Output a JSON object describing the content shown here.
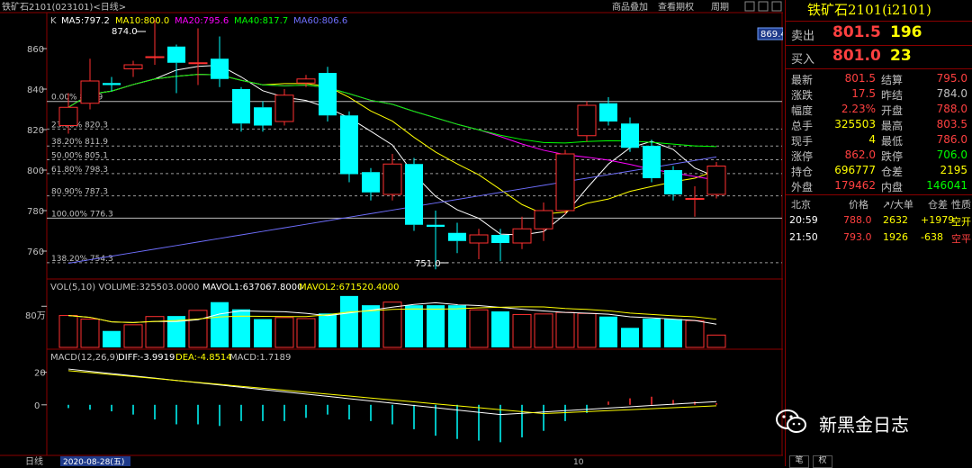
{
  "header": {
    "instrument": "铁矿石2101(023101)<日线>",
    "menu": [
      "商品叠加",
      "查看期权",
      "周期"
    ]
  },
  "overlays": {
    "ma_legend": [
      {
        "text": "K",
        "color": "#c0c0c0"
      },
      {
        "text": "MA5:797.2",
        "color": "#ffffff"
      },
      {
        "text": "MA10:800.0",
        "color": "#ffff00"
      },
      {
        "text": "MA20:795.6",
        "color": "#ff00ff"
      },
      {
        "text": "MA40:817.7",
        "color": "#00ff00"
      },
      {
        "text": "MA60:806.6",
        "color": "#6f6fff"
      }
    ],
    "price_tag": "869.4",
    "high_label": "874.0",
    "low_label": "751.0",
    "fib_levels": [
      {
        "label": "0.00% 833.9",
        "price": 833.9
      },
      {
        "label": "23.60% 820.3",
        "price": 820.3
      },
      {
        "label": "38.20% 811.9",
        "price": 811.9
      },
      {
        "label": "50.00% 805.1",
        "price": 805.1
      },
      {
        "label": "61.80% 798.3",
        "price": 798.3
      },
      {
        "label": "80.90% 787.3",
        "price": 787.3
      },
      {
        "label": "100.00% 776.3",
        "price": 776.3
      },
      {
        "label": "138.20% 754.3",
        "price": 754.3
      }
    ],
    "volume_legend": "VOL(5,10) VOLUME:325503.0000",
    "volume_mavol1": "MAVOL1:637067.8000",
    "volume_mavol2": "MAVOL2:671520.4000",
    "volume_axis_label": "80万",
    "macd_legend": "MACD(12,26,9)",
    "macd_diff": "DIFF:-3.9919",
    "macd_dea": "DEA:-4.8514",
    "macd_val": "MACD:1.7189",
    "bottom_period": "日线",
    "bottom_date": "2020-08-28(五)",
    "bottom_tick": "10"
  },
  "chart_data": {
    "type": "candlestick",
    "price_axis_ticks": [
      860,
      840,
      820,
      800,
      780,
      760
    ],
    "price_range": [
      748,
      876
    ],
    "candles": [
      {
        "o": 822,
        "c": 831,
        "h": 838,
        "l": 818
      },
      {
        "o": 833,
        "c": 844,
        "h": 855,
        "l": 830
      },
      {
        "o": 843,
        "c": 842,
        "h": 846,
        "l": 839
      },
      {
        "o": 850,
        "c": 852,
        "h": 854,
        "l": 846
      },
      {
        "o": 856,
        "c": 856,
        "h": 874,
        "l": 852
      },
      {
        "o": 861,
        "c": 853,
        "h": 862,
        "l": 838
      },
      {
        "o": 853,
        "c": 853,
        "h": 870,
        "l": 842
      },
      {
        "o": 855,
        "c": 845,
        "h": 866,
        "l": 841
      },
      {
        "o": 840,
        "c": 823,
        "h": 841,
        "l": 819
      },
      {
        "o": 831,
        "c": 822,
        "h": 834,
        "l": 819
      },
      {
        "o": 824,
        "c": 837,
        "h": 840,
        "l": 822
      },
      {
        "o": 843,
        "c": 845,
        "h": 847,
        "l": 841
      },
      {
        "o": 848,
        "c": 827,
        "h": 851,
        "l": 824
      },
      {
        "o": 827,
        "c": 798,
        "h": 829,
        "l": 794
      },
      {
        "o": 799,
        "c": 789,
        "h": 801,
        "l": 785
      },
      {
        "o": 788,
        "c": 803,
        "h": 808,
        "l": 785
      },
      {
        "o": 803,
        "c": 773,
        "h": 806,
        "l": 770
      },
      {
        "o": 773,
        "c": 772,
        "h": 780,
        "l": 751
      },
      {
        "o": 769,
        "c": 765,
        "h": 774,
        "l": 759
      },
      {
        "o": 764,
        "c": 768,
        "h": 771,
        "l": 756
      },
      {
        "o": 768,
        "c": 764,
        "h": 771,
        "l": 755
      },
      {
        "o": 764,
        "c": 771,
        "h": 777,
        "l": 761
      },
      {
        "o": 771,
        "c": 780,
        "h": 784,
        "l": 765
      },
      {
        "o": 780,
        "c": 808,
        "h": 810,
        "l": 778
      },
      {
        "o": 817,
        "c": 832,
        "h": 834,
        "l": 814
      },
      {
        "o": 833,
        "c": 824,
        "h": 836,
        "l": 822
      },
      {
        "o": 823,
        "c": 811,
        "h": 826,
        "l": 809
      },
      {
        "o": 812,
        "c": 796,
        "h": 815,
        "l": 794
      },
      {
        "o": 800,
        "c": 788,
        "h": 802,
        "l": 785
      },
      {
        "o": 786,
        "c": 786,
        "h": 792,
        "l": 777
      },
      {
        "o": 788,
        "c": 802,
        "h": 804,
        "l": 786
      }
    ],
    "volume": [
      62,
      55,
      32,
      44,
      60,
      61,
      72,
      88,
      74,
      55,
      58,
      56,
      66,
      100,
      82,
      88,
      82,
      82,
      82,
      73,
      70,
      64,
      65,
      68,
      66,
      60,
      38,
      56,
      55,
      52,
      24
    ],
    "volume_range": [
      0,
      105
    ],
    "macd_bars": [
      -2,
      -3,
      -4,
      -6,
      -9,
      -12,
      -12,
      -13,
      -10,
      -10,
      -10,
      -8,
      -6,
      -9,
      -10,
      -12,
      -15,
      -19,
      -21,
      -22,
      -23,
      -20,
      -16,
      -10,
      -5,
      2,
      4,
      5,
      3,
      2,
      1
    ],
    "macd_axis_ticks": [
      20,
      0
    ],
    "macd_range": [
      -30,
      32
    ]
  },
  "panel": {
    "title": "铁矿石2101(i2101)",
    "sell": {
      "label": "卖出",
      "price": "801.5",
      "qty": "196"
    },
    "buy": {
      "label": "买入",
      "price": "801.0",
      "qty": "23"
    },
    "stats": [
      {
        "l1": "最新",
        "v1": "801.5",
        "c1": "#ff4040",
        "l2": "结算",
        "v2": "795.0",
        "c2": "#ff4040"
      },
      {
        "l1": "涨跌",
        "v1": "17.5",
        "c1": "#ff4040",
        "l2": "昨结",
        "v2": "784.0",
        "c2": "#c0c0c0"
      },
      {
        "l1": "幅度",
        "v1": "2.23%",
        "c1": "#ff4040",
        "l2": "开盘",
        "v2": "788.0",
        "c2": "#ff4040"
      },
      {
        "l1": "总手",
        "v1": "325503",
        "c1": "#ffff00",
        "l2": "最高",
        "v2": "803.5",
        "c2": "#ff4040"
      },
      {
        "l1": "现手",
        "v1": "4",
        "c1": "#ffff00",
        "l2": "最低",
        "v2": "786.0",
        "c2": "#ff4040"
      },
      {
        "l1": "涨停",
        "v1": "862.0",
        "c1": "#ff4040",
        "l2": "跌停",
        "v2": "706.0",
        "c2": "#00ff00"
      },
      {
        "l1": "持仓",
        "v1": "696777",
        "c1": "#ffff00",
        "l2": "仓差",
        "v2": "2195",
        "c2": "#ffff00"
      },
      {
        "l1": "外盘",
        "v1": "179462",
        "c1": "#ff4040",
        "l2": "内盘",
        "v2": "146041",
        "c2": "#00ff00"
      }
    ],
    "ticks_header": [
      "北京",
      "价格",
      "↗/大单",
      "仓差",
      "性质"
    ],
    "ticks": [
      {
        "time": "20:59",
        "price": "788.0",
        "vol": "2632",
        "diff": "+1979",
        "nature": "空开"
      },
      {
        "time": "21:50",
        "price": "793.0",
        "vol": "1926",
        "diff": "-638",
        "nature": "空平"
      }
    ],
    "watermark": "新黑金日志",
    "bottom_buttons": [
      "笔",
      "权"
    ]
  }
}
